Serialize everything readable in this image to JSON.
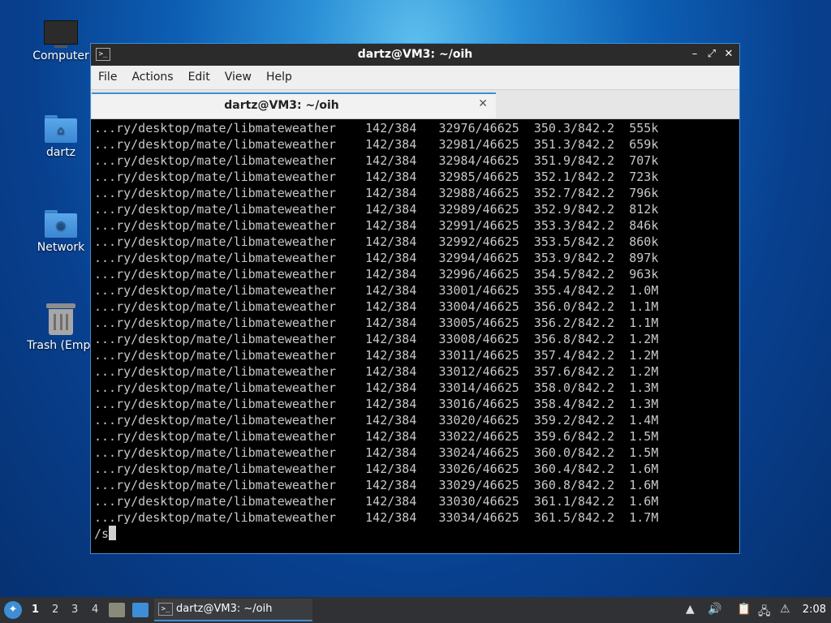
{
  "desktop": {
    "icons": [
      {
        "label": "Computer"
      },
      {
        "label": "dartz"
      },
      {
        "label": "Network"
      },
      {
        "label": "Trash (Empt"
      }
    ]
  },
  "window": {
    "title": "dartz@VM3: ~/oih",
    "menu": [
      "File",
      "Actions",
      "Edit",
      "View",
      "Help"
    ],
    "tab_label": "dartz@VM3: ~/oih",
    "close_glyph": "✕"
  },
  "terminal": {
    "lines": [
      "...ry/desktop/mate/libmateweather    142/384   32976/46625  350.3/842.2  555k",
      "...ry/desktop/mate/libmateweather    142/384   32981/46625  351.3/842.2  659k",
      "...ry/desktop/mate/libmateweather    142/384   32984/46625  351.9/842.2  707k",
      "...ry/desktop/mate/libmateweather    142/384   32985/46625  352.1/842.2  723k",
      "...ry/desktop/mate/libmateweather    142/384   32988/46625  352.7/842.2  796k",
      "...ry/desktop/mate/libmateweather    142/384   32989/46625  352.9/842.2  812k",
      "...ry/desktop/mate/libmateweather    142/384   32991/46625  353.3/842.2  846k",
      "...ry/desktop/mate/libmateweather    142/384   32992/46625  353.5/842.2  860k",
      "...ry/desktop/mate/libmateweather    142/384   32994/46625  353.9/842.2  897k",
      "...ry/desktop/mate/libmateweather    142/384   32996/46625  354.5/842.2  963k",
      "...ry/desktop/mate/libmateweather    142/384   33001/46625  355.4/842.2  1.0M",
      "...ry/desktop/mate/libmateweather    142/384   33004/46625  356.0/842.2  1.1M",
      "...ry/desktop/mate/libmateweather    142/384   33005/46625  356.2/842.2  1.1M",
      "...ry/desktop/mate/libmateweather    142/384   33008/46625  356.8/842.2  1.2M",
      "...ry/desktop/mate/libmateweather    142/384   33011/46625  357.4/842.2  1.2M",
      "...ry/desktop/mate/libmateweather    142/384   33012/46625  357.6/842.2  1.2M",
      "...ry/desktop/mate/libmateweather    142/384   33014/46625  358.0/842.2  1.3M",
      "...ry/desktop/mate/libmateweather    142/384   33016/46625  358.4/842.2  1.3M",
      "...ry/desktop/mate/libmateweather    142/384   33020/46625  359.2/842.2  1.4M",
      "...ry/desktop/mate/libmateweather    142/384   33022/46625  359.6/842.2  1.5M",
      "...ry/desktop/mate/libmateweather    142/384   33024/46625  360.0/842.2  1.5M",
      "...ry/desktop/mate/libmateweather    142/384   33026/46625  360.4/842.2  1.6M",
      "...ry/desktop/mate/libmateweather    142/384   33029/46625  360.8/842.2  1.6M",
      "...ry/desktop/mate/libmateweather    142/384   33030/46625  361.1/842.2  1.6M",
      "...ry/desktop/mate/libmateweather    142/384   33034/46625  361.5/842.2  1.7M"
    ],
    "prompt": "/s"
  },
  "taskbar": {
    "workspaces": [
      "1",
      "2",
      "3",
      "4"
    ],
    "task_label": "dartz@VM3: ~/oih",
    "clock": "2:08"
  },
  "colors": {
    "accent": "#3d8ed6",
    "terminal_bg": "#000000",
    "terminal_fg": "#c8c8c8"
  }
}
